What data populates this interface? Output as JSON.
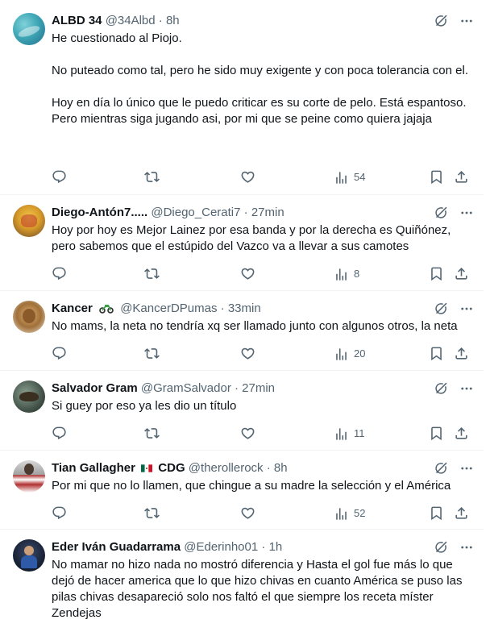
{
  "colors": {
    "text": "#0f1419",
    "muted": "#536471",
    "divider": "#eff3f4",
    "background": "#ffffff"
  },
  "icons": [
    "grok-icon",
    "more-icon",
    "reply-icon",
    "retweet-icon",
    "like-icon",
    "views-icon",
    "bookmark-icon",
    "share-icon"
  ],
  "tweets": [
    {
      "name": "ALBD 34",
      "handle": "@34Albd",
      "dot": "·",
      "time": "8h",
      "paragraphs": [
        "He cuestionado al Piojo.",
        "No puteado como tal, pero he sido muy exigente y con poca tolerancia con el.",
        "Hoy en día lo único que le puedo criticar es su corte de pelo. Está espantoso. Pero mientras siga jugando asi, por mi que se peine como quiera jajaja"
      ],
      "views": "54"
    },
    {
      "name": "Diego-Antón7.....",
      "handle": "@Diego_Cerati7",
      "dot": "·",
      "time": "27min",
      "paragraphs": [
        "Hoy por hoy es Mejor Lainez por esa banda y por la derecha es Quiñónez, pero sabemos que el estúpido del Vazco  va a llevar a sus camotes"
      ],
      "views": "8"
    },
    {
      "name": "Kancer",
      "handle": "@KancerDPumas",
      "dot": "·",
      "time": "33min",
      "paragraphs": [
        "No mams, la neta no tendría xq ser llamado junto con algunos otros, la neta"
      ],
      "views": "20"
    },
    {
      "name": "Salvador Gram",
      "handle": "@GramSalvador",
      "dot": "·",
      "time": "27min",
      "paragraphs": [
        "Si guey por eso ya les dio un título"
      ],
      "views": "11"
    },
    {
      "name": "Tian Gallagher",
      "name_suffix": "CDG",
      "handle": "@therollerock",
      "dot": "·",
      "time": "8h",
      "paragraphs": [
        "Por mi que no lo llamen, que chingue a su madre la selección y el América"
      ],
      "views": "52"
    },
    {
      "name": "Eder Iván Guadarrama",
      "handle": "@Ederinho01",
      "dot": "·",
      "time": "1h",
      "paragraphs": [
        "No mamar no hizo nada no mostró diferencia y Hasta el gol fue más lo que dejó de hacer america que lo que hizo chivas en cuanto América se puso las pilas chivas desapareció solo nos faltó el que siempre los receta míster Zendejas"
      ]
    }
  ]
}
